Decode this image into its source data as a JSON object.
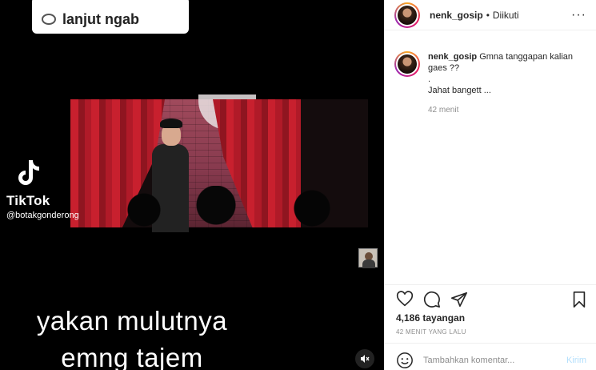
{
  "video": {
    "comment_reply": "lanjut ngab",
    "watermark": {
      "brand": "TikTok",
      "handle": "@botakgonderong"
    },
    "subtitles": [
      "yakan mulutnya",
      "emng tajem"
    ],
    "icons": {
      "comment": "speech-bubble-icon",
      "mute": "speaker-muted-icon"
    }
  },
  "header": {
    "username": "nenk_gosip",
    "separator": "•",
    "follow_status": "Diikuti",
    "more": "···"
  },
  "post": {
    "username": "nenk_gosip",
    "caption_lines": [
      "Gmna tanggapan kalian gaes ??",
      ".",
      "Jahat bangett ..."
    ],
    "time": "42 menit"
  },
  "actions": {
    "icons": [
      "heart-icon",
      "comment-icon",
      "share-icon",
      "bookmark-icon"
    ]
  },
  "stats": {
    "views": "4,186 tayangan",
    "posted": "42 MENIT YANG LALU"
  },
  "comment_box": {
    "placeholder": "Tambahkan komentar...",
    "send_label": "Kirim"
  }
}
